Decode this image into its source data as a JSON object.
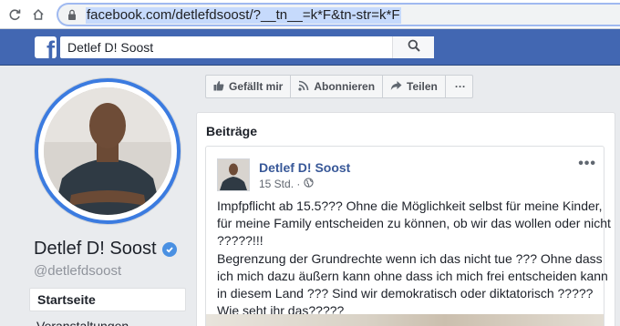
{
  "browser": {
    "url": "facebook.com/detlefdsoost/?__tn__=k*F&tn-str=k*F"
  },
  "header": {
    "logo": "f",
    "search_value": "Detlef D! Soost"
  },
  "profile": {
    "name": "Detlef D! Soost",
    "handle": "@detlefdsoost",
    "nav": [
      "Startseite",
      "Veranstaltungen"
    ]
  },
  "actions": [
    {
      "label": "Gefällt mir",
      "icon": "thumbs-up-icon"
    },
    {
      "label": "Abonnieren",
      "icon": "rss-icon"
    },
    {
      "label": "Teilen",
      "icon": "share-arrow-icon"
    },
    {
      "label": "···",
      "icon": "more-icon"
    }
  ],
  "feed": {
    "title": "Beiträge",
    "post": {
      "author": "Detlef D! Soost",
      "time": "15 Std. · ",
      "text_lines": [
        "Impfpflicht ab 15.5??? Ohne die Möglichkeit selbst für meine Kinder,",
        "für meine Family entscheiden zu können, ob wir das wollen oder nicht",
        "?????!!!",
        "Begrenzung der Grundrechte wenn ich das nicht tue ??? Ohne dass",
        "ich mich dazu äußern kann ohne dass ich mich frei entscheiden kann",
        "in diesem Land ??? Sind wir demokratisch oder diktatorisch ?????",
        "Wie seht ihr das?????"
      ]
    }
  },
  "colors": {
    "fb_blue": "#4267b2",
    "link_blue": "#385898",
    "verified_blue": "#4a90e2"
  }
}
